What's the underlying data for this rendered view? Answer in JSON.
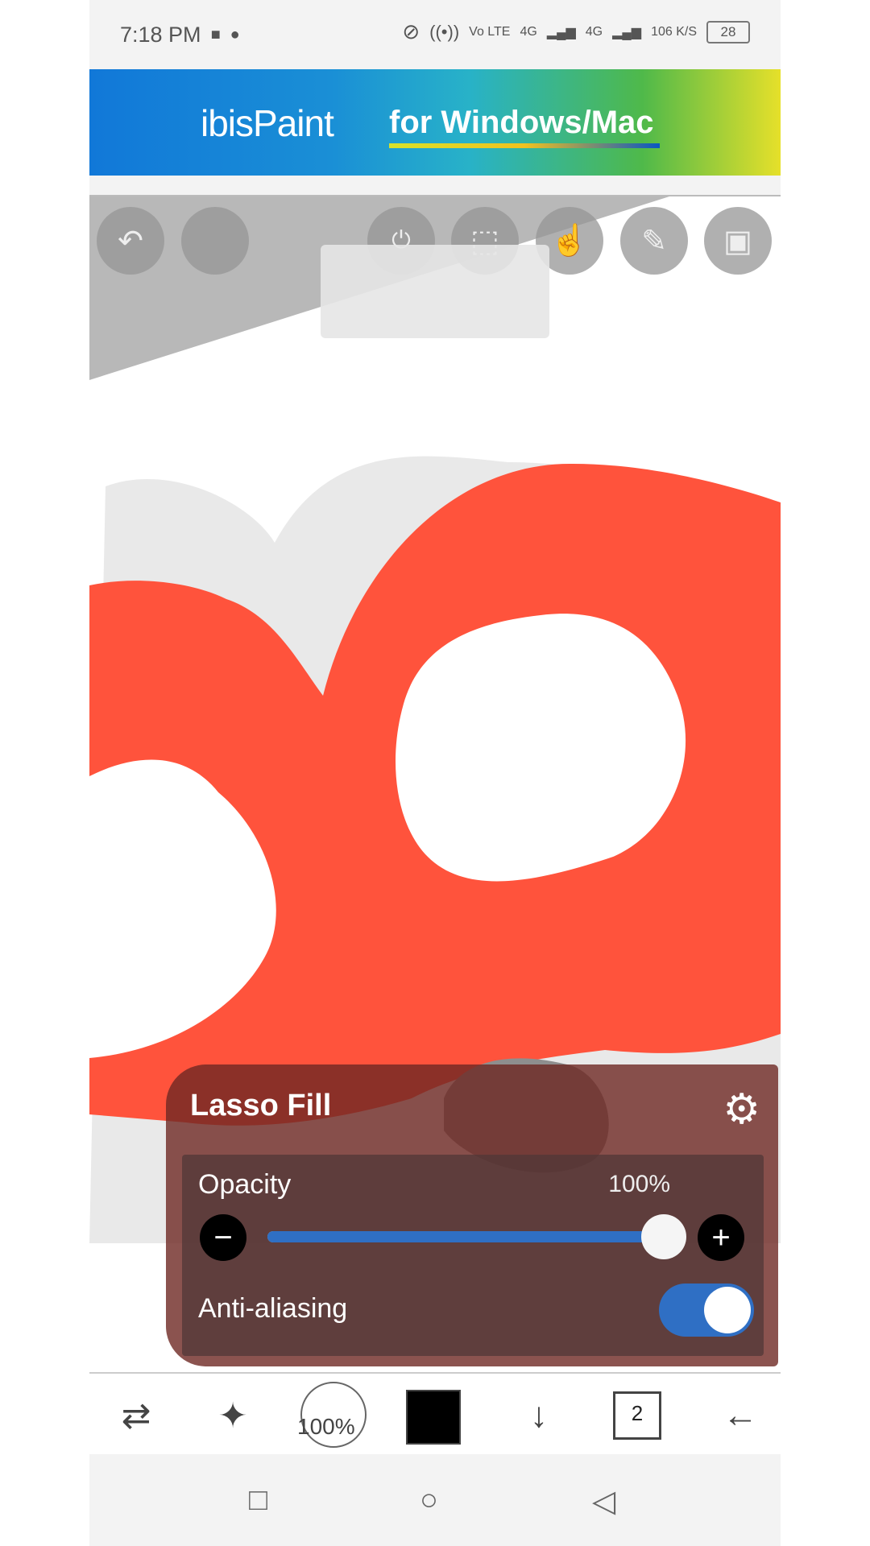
{
  "status_bar": {
    "time": "7:18 PM",
    "network_left": "Vo LTE",
    "network_4g_1": "4G",
    "network_4g_2": "4G",
    "speed": "106 K/S",
    "battery": "28"
  },
  "banner": {
    "logo": "ibisPaint",
    "tagline": "for Windows/Mac"
  },
  "lasso_fill_panel": {
    "title": "Lasso Fill",
    "opacity_label": "Opacity",
    "opacity_value": "100%",
    "opacity_fraction": 1.0,
    "anti_aliasing_label": "Anti-aliasing",
    "anti_aliasing_on": true
  },
  "bottom_toolbar": {
    "brush_size_value": "100%",
    "current_color": "#000000",
    "layer_count": "2"
  },
  "colors": {
    "shape_fill": "#ff533c",
    "accent_blue": "#2f6fc4"
  }
}
